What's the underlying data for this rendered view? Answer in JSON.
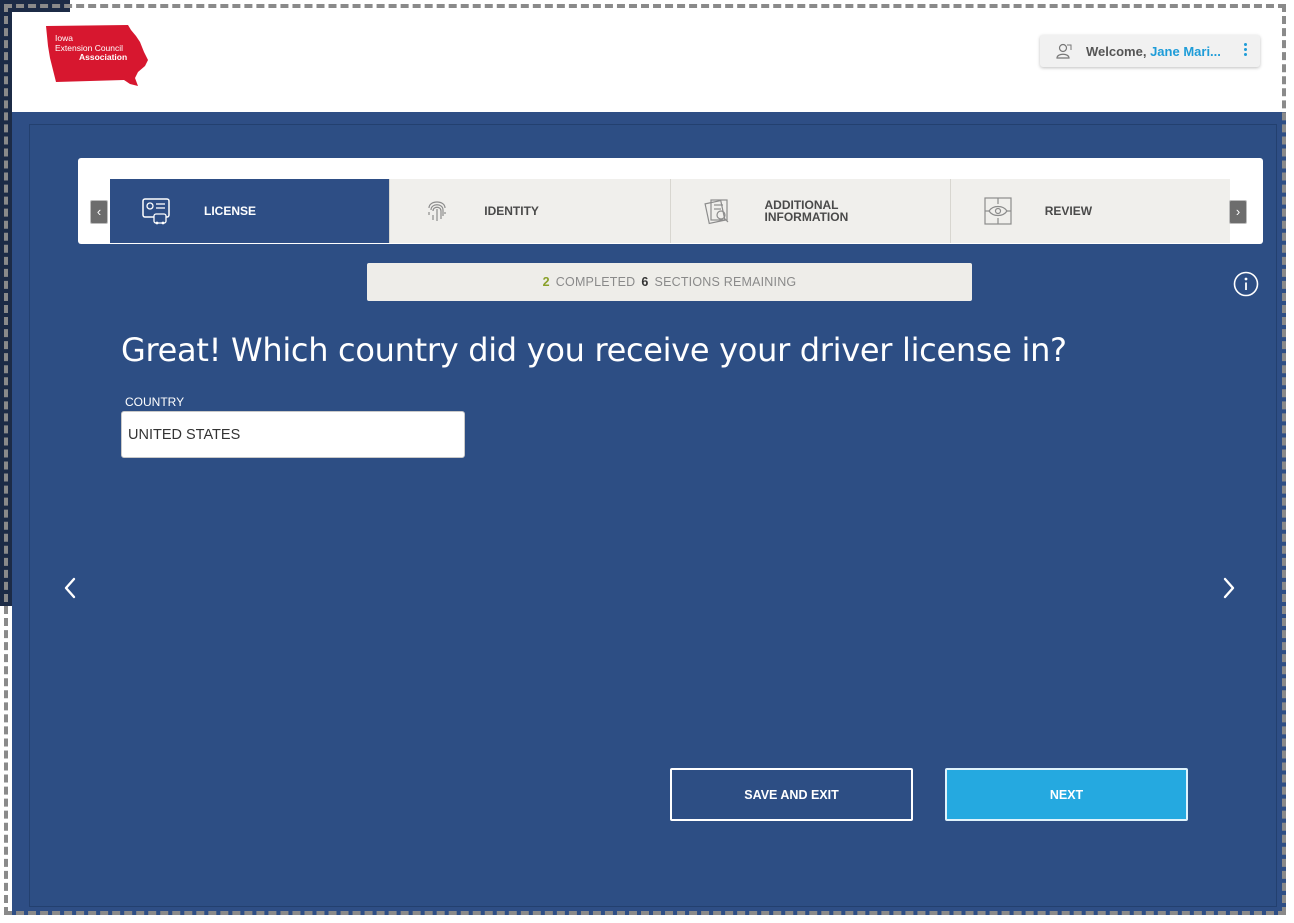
{
  "header": {
    "logo": {
      "line1": "Iowa",
      "line2": "Extension Council",
      "line3": "Association",
      "color": "#d7172f"
    },
    "user": {
      "welcome_prefix": "Welcome,",
      "name": "Jane Mari...",
      "icon": "user-icon",
      "menu_icon": "kebab-menu-icon"
    }
  },
  "steps": [
    {
      "label": "LICENSE",
      "icon": "license-card-icon",
      "active": true
    },
    {
      "label": "IDENTITY",
      "icon": "fingerprint-icon",
      "active": false
    },
    {
      "label": "ADDITIONAL INFORMATION",
      "icon": "document-search-icon",
      "active": false
    },
    {
      "label": "REVIEW",
      "icon": "eye-icon",
      "active": false
    }
  ],
  "progress": {
    "completed": "2",
    "completed_label": "COMPLETED",
    "remaining": "6",
    "remaining_label": "SECTIONS REMAINING"
  },
  "form": {
    "question": "Great! Which country did you receive your driver license in?",
    "country_label": "COUNTRY",
    "country_value": "UNITED STATES"
  },
  "actions": {
    "save_label": "SAVE AND EXIT",
    "next_label": "NEXT"
  },
  "colors": {
    "panel": "#2e4e85",
    "accent": "#25a9e0",
    "completed": "#8aa12a"
  }
}
